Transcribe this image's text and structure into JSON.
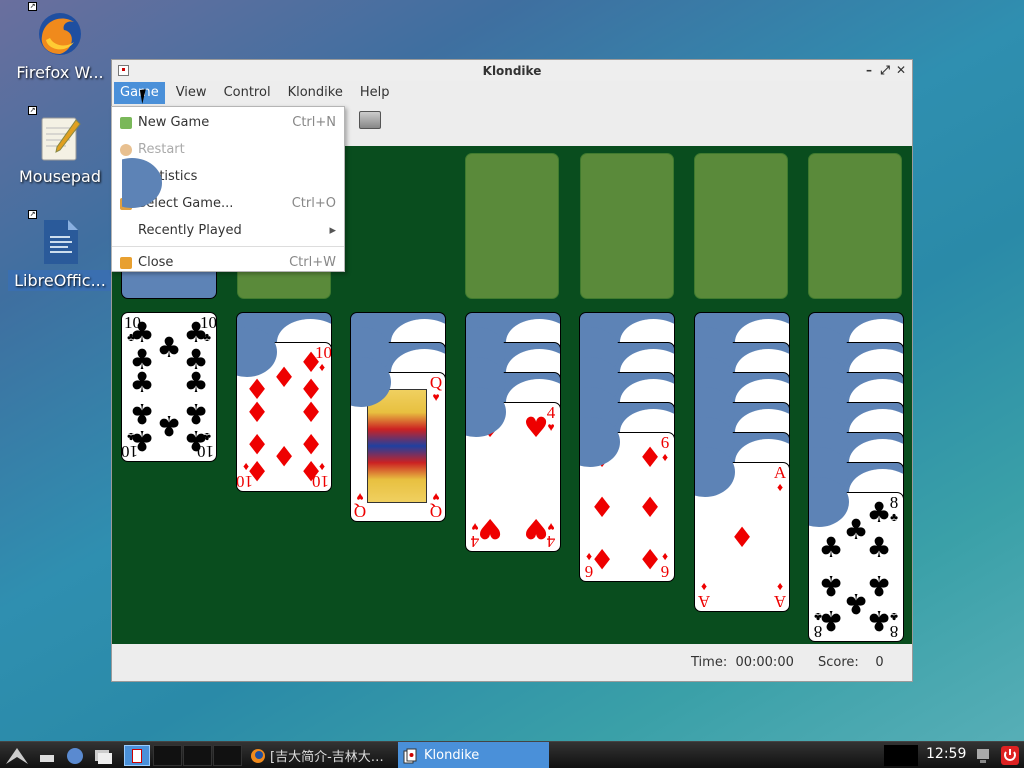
{
  "desktop": {
    "icons": [
      {
        "label": "Firefox W...",
        "icon": "firefox-icon"
      },
      {
        "label": "Mousepad",
        "icon": "mousepad-icon"
      },
      {
        "label": "LibreOffic...",
        "icon": "libreoffice-writer-icon"
      }
    ]
  },
  "window": {
    "title": "Klondike",
    "controls": {
      "minimize": "–",
      "maximize": "⤢",
      "close": "✕"
    },
    "menubar": [
      "Game",
      "View",
      "Control",
      "Klondike",
      "Help"
    ],
    "status": {
      "time_label": "Time:",
      "time_value": "00:00:00",
      "score_label": "Score:",
      "score_value": "0"
    }
  },
  "game_menu": {
    "items": [
      {
        "label": "New Game",
        "accel": "Ctrl+N",
        "icon": "new-game-icon",
        "enabled": true
      },
      {
        "label": "Restart",
        "accel": "",
        "icon": "restart-icon",
        "enabled": false
      },
      {
        "label": "Statistics",
        "accel": "",
        "icon": "",
        "enabled": true
      },
      {
        "label": "Select Game...",
        "accel": "Ctrl+O",
        "icon": "select-game-icon",
        "enabled": true
      },
      {
        "label": "Recently Played",
        "accel": "▸",
        "icon": "",
        "enabled": true
      },
      {
        "label": "Close",
        "accel": "Ctrl+W",
        "icon": "close-icon",
        "enabled": true
      }
    ]
  },
  "tableau": {
    "columns": [
      {
        "hidden": 0,
        "top": {
          "rank": "10",
          "suit": "♣",
          "color": "black"
        }
      },
      {
        "hidden": 1,
        "top": {
          "rank": "10",
          "suit": "♦",
          "color": "red"
        }
      },
      {
        "hidden": 2,
        "top": {
          "rank": "Q",
          "suit": "♥",
          "color": "red"
        }
      },
      {
        "hidden": 3,
        "top": {
          "rank": "4",
          "suit": "♥",
          "color": "red"
        }
      },
      {
        "hidden": 4,
        "top": {
          "rank": "6",
          "suit": "♦",
          "color": "red"
        }
      },
      {
        "hidden": 5,
        "top": {
          "rank": "A",
          "suit": "♦",
          "color": "red"
        }
      },
      {
        "hidden": 6,
        "top": {
          "rank": "8",
          "suit": "♣",
          "color": "black"
        }
      }
    ]
  },
  "taskbar": {
    "tasks": [
      {
        "label": "[吉大简介-吉林大…",
        "icon": "firefox-icon",
        "active": false
      },
      {
        "label": "Klondike",
        "icon": "cards-icon",
        "active": true
      }
    ],
    "clock": "12:59"
  },
  "colors": {
    "felt": "#094d1e",
    "slot": "#5a8a3a",
    "card_back": "#5d83b6",
    "menu_highlight": "#4a90d9"
  }
}
